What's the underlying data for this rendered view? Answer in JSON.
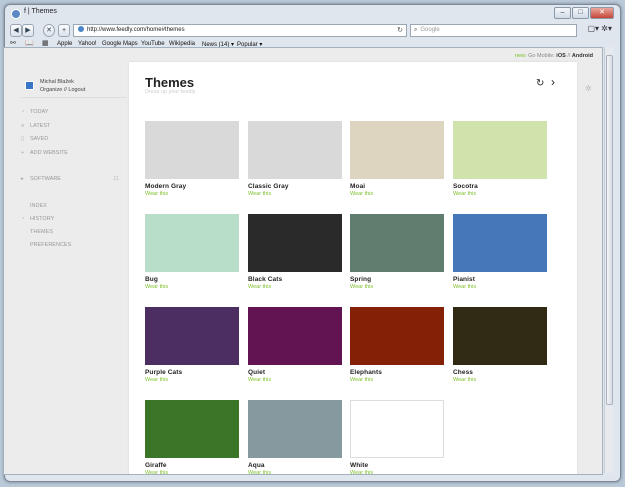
{
  "window": {
    "title": "f | Themes",
    "controls": [
      "–",
      "□",
      "✕"
    ]
  },
  "toolbar": {
    "back": "◀",
    "forward": "▶",
    "stop": "✕",
    "add": "+",
    "url": "http://www.feedly.com/home#themes",
    "reload": "↻",
    "search_placeholder": "Google",
    "search_icon": "⌕",
    "right_icons": "▢▾ ✲▾"
  },
  "bookmarks": {
    "icons": [
      "⚯",
      "📖",
      "▦"
    ],
    "items": [
      "Apple",
      "Yahoo!",
      "Google Maps",
      "YouTube",
      "Wikipedia",
      "News (14) ▾",
      "Popular ▾"
    ]
  },
  "topline": {
    "new": "new:",
    "go": "Go Mobile:",
    "ios": "iOS",
    "sep": "//",
    "android": "Android"
  },
  "sidebar": {
    "user_name": "Michal Blažek",
    "user_links": "Organize // Logout",
    "nav": [
      {
        "icon": "◔",
        "label": "TODAY"
      },
      {
        "icon": "≡",
        "label": "LATEST"
      },
      {
        "icon": "▯",
        "label": "SAVED"
      },
      {
        "icon": "+",
        "label": "ADD WEBSITE"
      },
      {
        "icon": "▸",
        "label": "SOFTWARE",
        "count": "11"
      },
      {
        "icon": "",
        "label": "INDEX"
      },
      {
        "icon": "◔",
        "label": "HISTORY"
      },
      {
        "icon": "",
        "label": "THEMES"
      },
      {
        "icon": "",
        "label": "PREFERENCES"
      }
    ]
  },
  "main": {
    "title": "Themes",
    "subtitle": "Dress up your feedly",
    "refresh": "↻",
    "next": "›",
    "wear_label": "Wear this"
  },
  "themes": [
    {
      "name": "Modern Gray",
      "color": "#d9d9d9"
    },
    {
      "name": "Classic Gray",
      "color": "#d9d9d9"
    },
    {
      "name": "Moai",
      "color": "#ddd5c0"
    },
    {
      "name": "Socotra",
      "color": "#d1e3ad"
    },
    {
      "name": "Bug",
      "color": "#b8ddc8"
    },
    {
      "name": "Black Cats",
      "color": "#2a2a2a"
    },
    {
      "name": "Spring",
      "color": "#5f7e6f"
    },
    {
      "name": "Pianist",
      "color": "#4577b9"
    },
    {
      "name": "Purple Cats",
      "color": "#4c2e62"
    },
    {
      "name": "Quiet",
      "color": "#621352"
    },
    {
      "name": "Elephants",
      "color": "#832006"
    },
    {
      "name": "Chess",
      "color": "#312a14"
    },
    {
      "name": "Giraffe",
      "color": "#3b7528"
    },
    {
      "name": "Aqua",
      "color": "#86999f"
    },
    {
      "name": "White",
      "color": "#ffffff"
    }
  ],
  "gear": "✲"
}
